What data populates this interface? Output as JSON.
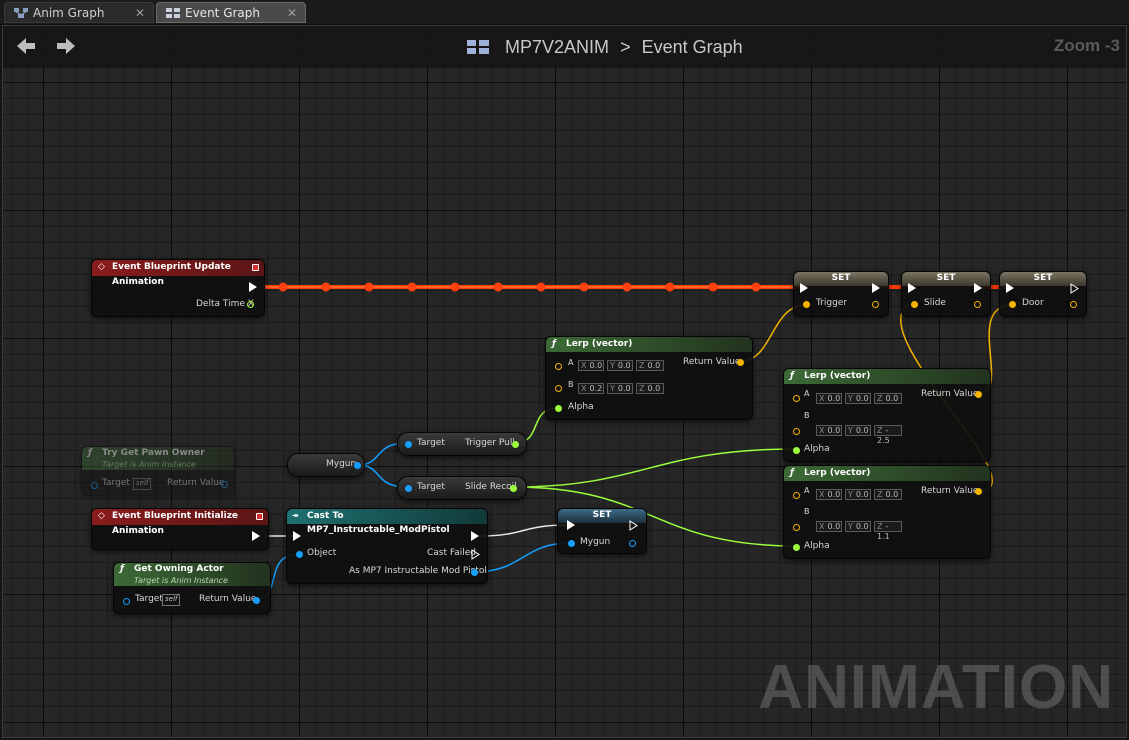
{
  "tabs": [
    {
      "label": "Anim Graph",
      "icon": "anim-graph-icon",
      "active": false
    },
    {
      "label": "Event Graph",
      "icon": "event-graph-icon",
      "active": true
    }
  ],
  "header": {
    "breadcrumb_root": "MP7V2ANIM",
    "separator": ">",
    "breadcrumb_current": "Event Graph",
    "zoom": "Zoom -3"
  },
  "watermark": "ANIMATION",
  "colors": {
    "exec": "#ffffff",
    "exec_wire": "#ff3c00",
    "float_pin": "#9cff3c",
    "vector_pin": "#f5b400",
    "object_pin": "#14a0ff",
    "event_header": "#8a1c1c",
    "function_header": "#3c6a36",
    "cast_header": "#1a6a6a",
    "set_header": "#5a5a5a"
  },
  "nodes": {
    "update_event": {
      "title": "Event Blueprint Update Animation",
      "out_pin": "Delta Time X"
    },
    "set1": {
      "title": "SET",
      "pin": "Trigger"
    },
    "set2": {
      "title": "SET",
      "pin": "Slide"
    },
    "set3": {
      "title": "SET",
      "pin": "Door"
    },
    "lerp1": {
      "title": "Lerp (vector)",
      "a_label": "A",
      "a": {
        "x": "0.0",
        "y": "0.0",
        "z": "0.0"
      },
      "b_label": "B",
      "b": {
        "x": "0.2",
        "y": "0.0",
        "z": "0.0"
      },
      "alpha": "Alpha",
      "ret": "Return Value"
    },
    "lerp2": {
      "title": "Lerp (vector)",
      "a_label": "A",
      "a": {
        "x": "0.0",
        "y": "0.0",
        "z": "0.0"
      },
      "b_label": "B",
      "b": {
        "x": "0.0",
        "y": "0.0",
        "z": "-2.5"
      },
      "alpha": "Alpha",
      "ret": "Return Value"
    },
    "lerp3": {
      "title": "Lerp (vector)",
      "a_label": "A",
      "a": {
        "x": "0.0",
        "y": "0.0",
        "z": "0.0"
      },
      "b_label": "B",
      "b": {
        "x": "0.0",
        "y": "0.0",
        "z": "-1.1"
      },
      "alpha": "Alpha",
      "ret": "Return Value"
    },
    "pawn_owner": {
      "title": "Try Get Pawn Owner",
      "subtitle": "Target is Anim Instance",
      "target": "Target",
      "self": "self",
      "ret": "Return Value"
    },
    "mygun": {
      "label": "Mygun"
    },
    "trigger_get": {
      "target": "Target",
      "out": "Trigger Pull"
    },
    "slide_get": {
      "target": "Target",
      "out": "Slide Recoil"
    },
    "init_event": {
      "title": "Event Blueprint Initialize Animation"
    },
    "cast": {
      "title": "Cast To MP7_Instructable_ModPistol",
      "object": "Object",
      "failed": "Cast Failed",
      "as": "As MP7 Instructable Mod Pistol"
    },
    "set_mygun": {
      "title": "SET",
      "pin": "Mygun"
    },
    "owning_actor": {
      "title": "Get Owning Actor",
      "subtitle": "Target is Anim Instance",
      "target": "Target",
      "self": "self",
      "ret": "Return Value"
    }
  },
  "axis_labels": {
    "x": "X",
    "y": "Y",
    "z": "Z"
  }
}
